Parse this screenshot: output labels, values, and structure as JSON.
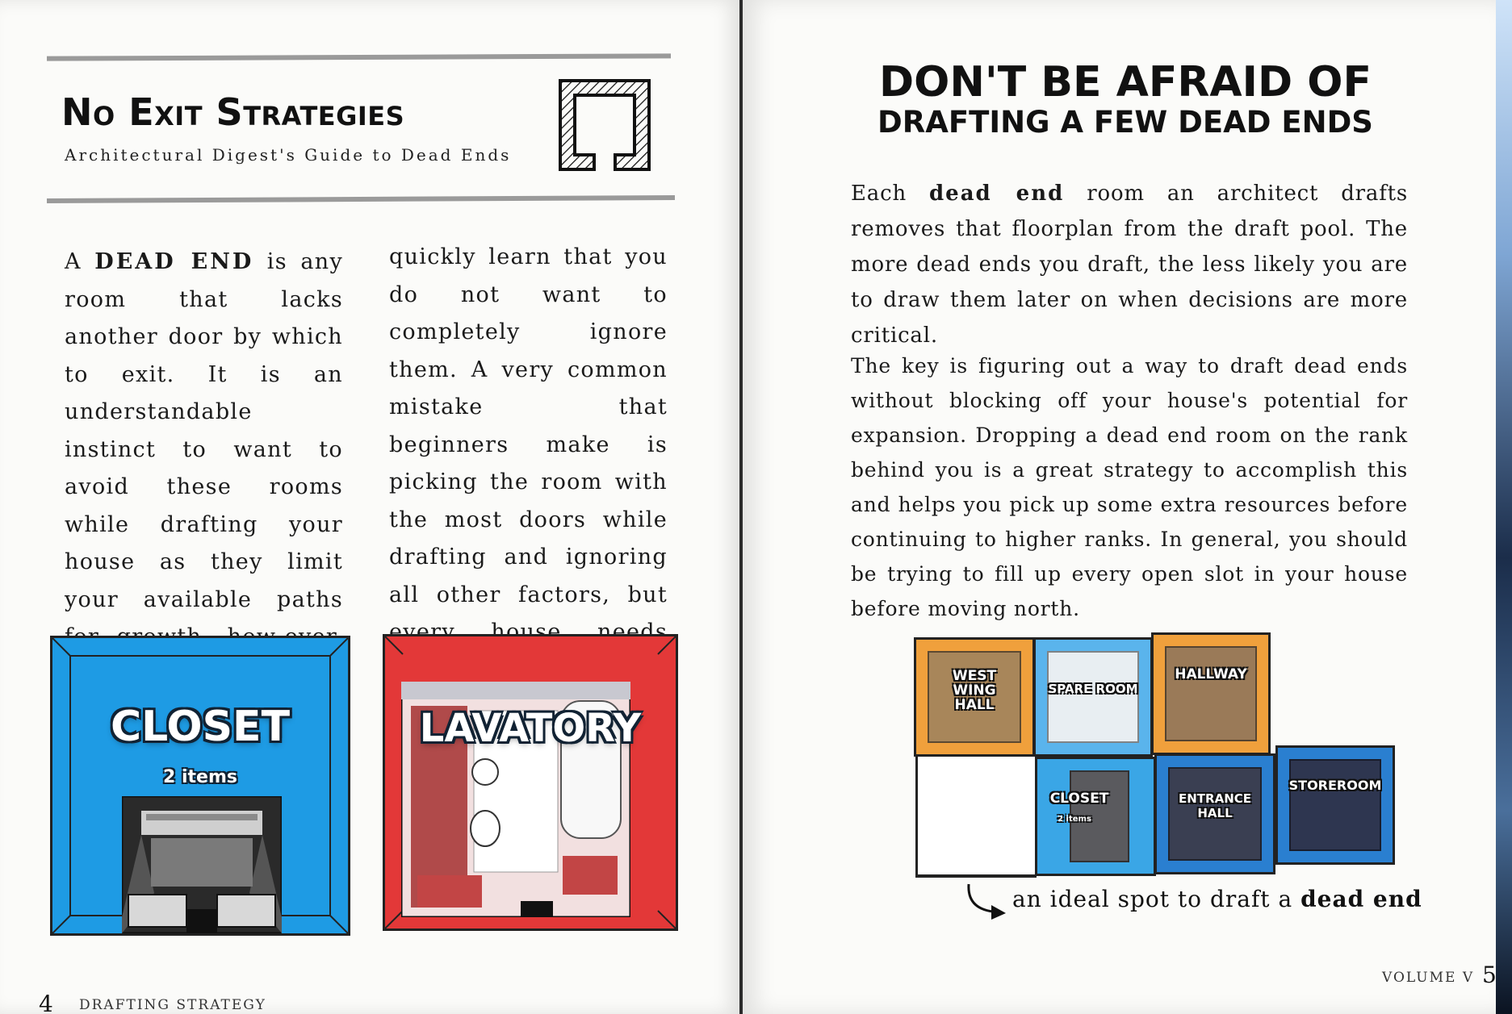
{
  "left_page": {
    "title": "No Exit Strategies",
    "subtitle": "Architectural Digest's Guide to Dead Ends",
    "logo_icon": "dead-end-room-icon",
    "column1": {
      "lead": "A ",
      "bold": "DEAD END",
      "text": " is any room that lacks another door by which to exit. It is an understandable instinct to want to avoid these rooms while drafting your house as they limit your available paths for growth, how-ever, seasoned architects"
    },
    "column2": "quickly learn that you do not want to completely ignore them. A very common mistake that beginners make is picking the room with the most doors while drafting and ignoring all other factors, but every house needs some dead ends.",
    "cards": [
      {
        "name": "CLOSET",
        "items": "2 items",
        "color": "#1e9be4"
      },
      {
        "name": "LAVATORY",
        "color": "#e33838"
      }
    ],
    "footer_number": "4",
    "footer_label": "DRAFTING STRATEGY"
  },
  "right_page": {
    "title_line1": "DON'T BE AFRAID  OF",
    "title_line2": "DRAFTING A FEW DEAD ENDS",
    "para1": {
      "lead": "Each ",
      "bold": "dead end",
      "text": " room an architect drafts removes that floorplan from the draft pool. The more dead ends you draft, the less likely you are to draw them later on when decisions are more critical."
    },
    "para2": "The key is figuring out a way to draft dead ends without blocking off your house's potential for expansion. Dropping a dead end room on the rank behind you is a great strategy to accomplish this and helps you pick up some extra resources before continuing to higher ranks. In general, you should be trying to fill up every open slot in your house before moving north.",
    "diagram": {
      "rooms": [
        {
          "label": "WEST WING HALL",
          "color": "#f0a03c"
        },
        {
          "label": "SPARE ROOM",
          "color": "#5ab4ec"
        },
        {
          "label": "HALLWAY",
          "color": "#f0a03c"
        },
        {
          "label": "CLOSET",
          "sub": "2 items",
          "color": "#3aa6e6"
        },
        {
          "label": "ENTRANCE HALL",
          "color": "#2a7fd0"
        },
        {
          "label": "STOREROOM",
          "color": "#2a7fd0"
        }
      ],
      "caption_lead": "an ideal spot to draft a ",
      "caption_bold": "dead end"
    },
    "footer_label": "VOLUME V",
    "footer_number": "5"
  }
}
